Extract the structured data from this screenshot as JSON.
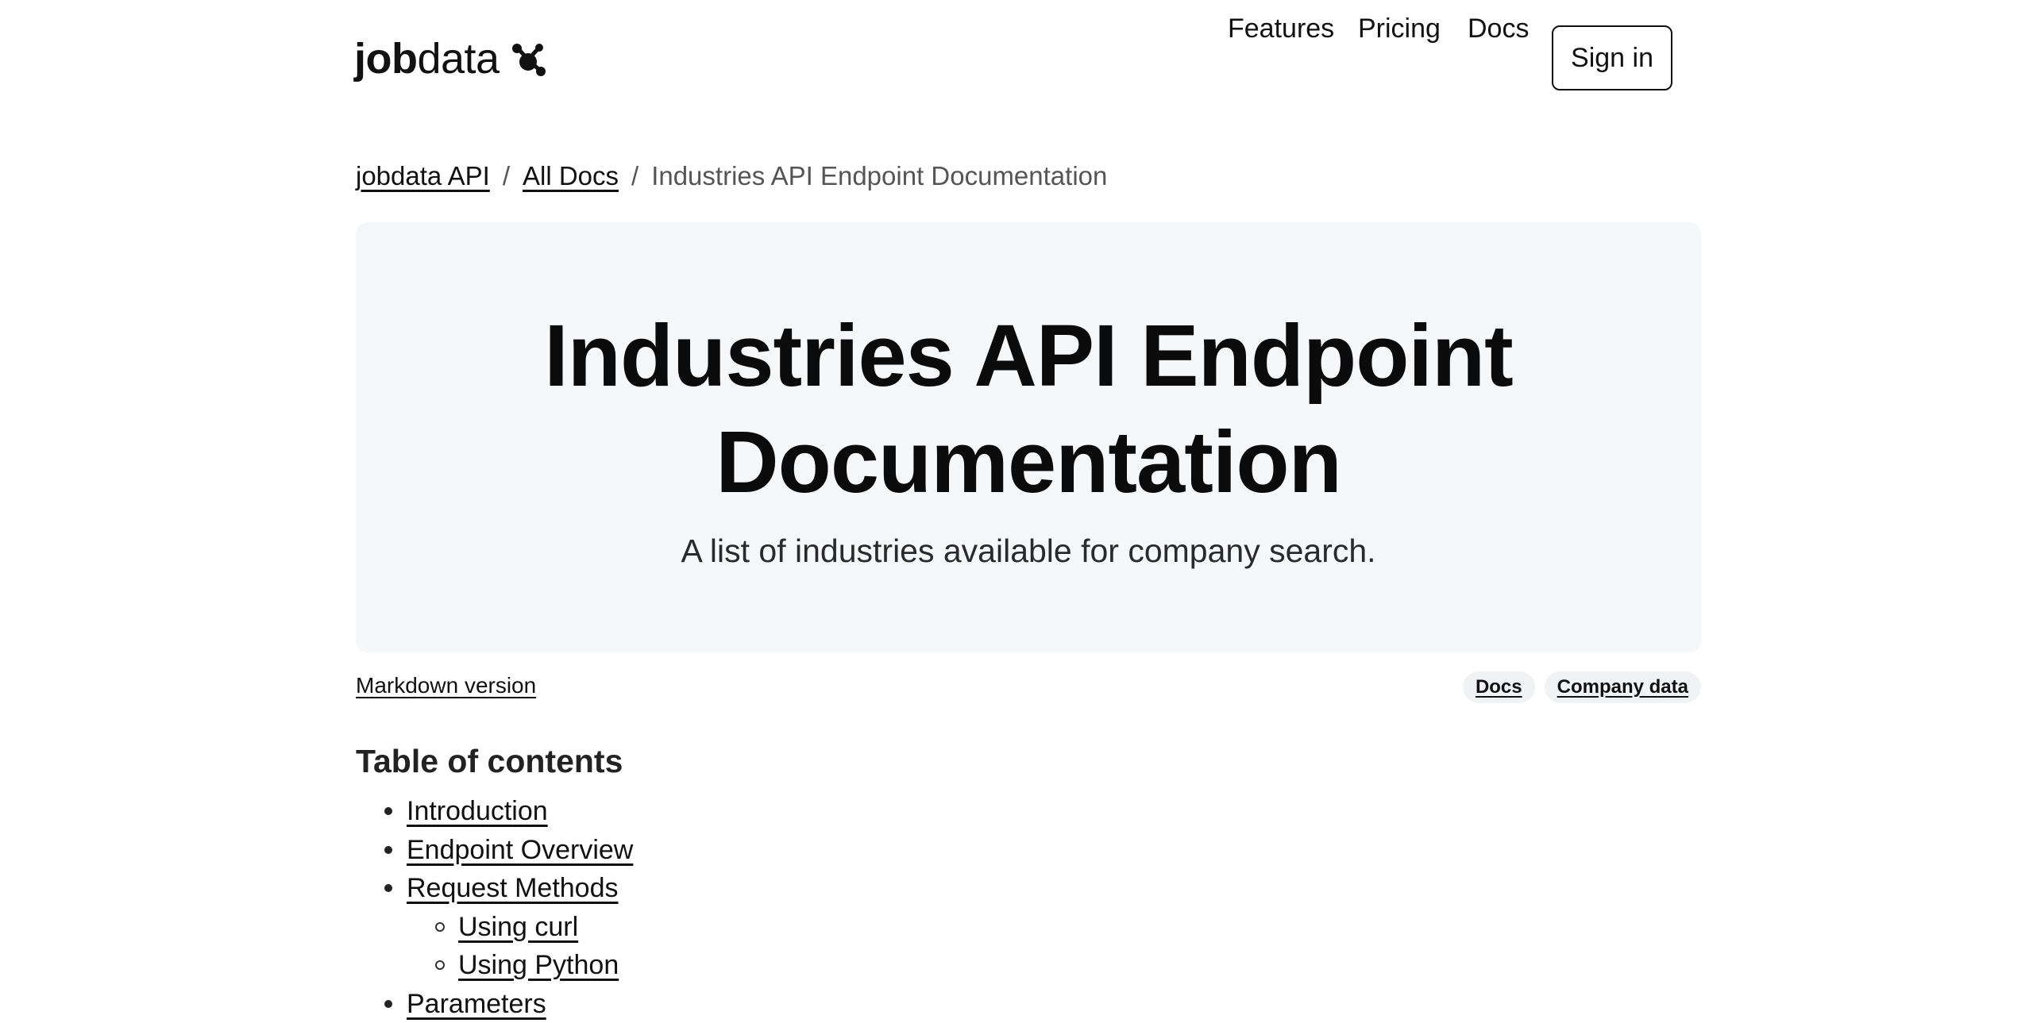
{
  "header": {
    "logo_bold": "job",
    "logo_light": "data",
    "logo_icon": "molecule-icon",
    "nav": [
      "Features",
      "Pricing",
      "Docs"
    ],
    "signin_label": "Sign in"
  },
  "breadcrumb": {
    "items": [
      "jobdata API",
      "All Docs"
    ],
    "separator": "/",
    "current": "Industries API Endpoint Documentation"
  },
  "hero": {
    "title_line1": "Industries API Endpoint",
    "title_line2": "Documentation",
    "subtitle": "A list of industries available for company search."
  },
  "meta": {
    "markdown_link": "Markdown version",
    "tags": [
      "Docs",
      "Company data"
    ]
  },
  "toc": {
    "heading": "Table of contents",
    "items": [
      {
        "label": "Introduction",
        "level": 1
      },
      {
        "label": "Endpoint Overview",
        "level": 1
      },
      {
        "label": "Request Methods",
        "level": 1
      },
      {
        "label": "Using curl",
        "level": 2
      },
      {
        "label": "Using Python",
        "level": 2
      },
      {
        "label": "Parameters",
        "level": 1
      }
    ]
  },
  "colors": {
    "text": "#111111",
    "muted": "#555555",
    "hero_bg": "#f6f7f9",
    "tag_bg": "#f1f2f4"
  }
}
